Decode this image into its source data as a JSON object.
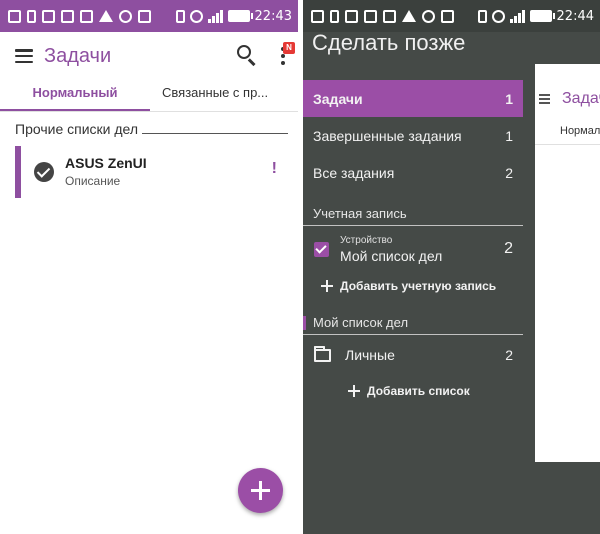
{
  "left": {
    "status_time": "22:43",
    "app_title": "Задачи",
    "menu_badge": "N",
    "tabs": [
      {
        "label": "Нормальный"
      },
      {
        "label": "Связанные с пр..."
      }
    ],
    "section_title": "Прочие списки дел",
    "task": {
      "title": "ASUS ZenUI",
      "description": "Описание",
      "priority_mark": "!"
    }
  },
  "right": {
    "status_time": "22:44",
    "drawer_title": "Сделать позже",
    "nav_items": [
      {
        "label": "Задачи",
        "count": "1"
      },
      {
        "label": "Завершенные задания",
        "count": "1"
      },
      {
        "label": "Все задания",
        "count": "2"
      }
    ],
    "account_section": {
      "title": "Учетная запись",
      "account_type": "Устройство",
      "account_name": "Мой список дел",
      "account_count": "2",
      "add_label": "Добавить учетную запись"
    },
    "list_section": {
      "title": "Мой список дел",
      "list_name": "Личные",
      "list_count": "2",
      "add_label": "Добавить список"
    },
    "behind": {
      "title": "Задачи",
      "tab": "Нормальный"
    }
  },
  "colors": {
    "accent": "#8e4fa0",
    "drawer_bg": "#454a47",
    "badge": "#e53935"
  }
}
